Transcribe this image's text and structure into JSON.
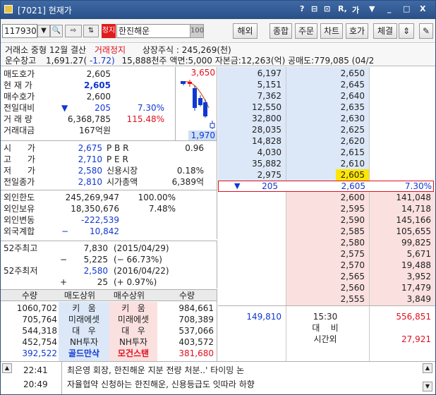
{
  "window": {
    "title": "[7021] 현재가",
    "buttons": [
      "?",
      "⊟",
      "⊡",
      "R,",
      "가",
      "▼",
      "_",
      "□",
      "X"
    ]
  },
  "toolbar": {
    "code": "117930",
    "short_tag": "정지",
    "name": "한진해운",
    "suffix": "100",
    "buttons": [
      "해외",
      "종합",
      "주문",
      "차트",
      "호가",
      "체결"
    ]
  },
  "info": {
    "line1_a": "거래소 중형 12월 결산",
    "line1_b": "거래정지",
    "line1_c": "상장주식 : 245,269(천)",
    "line2_a": "운수창고",
    "line2_b": "1,691.27(",
    "line2_c": "-1.72)",
    "line2_d": "15,888천주 액면:5,000 자본금:12,263(억) 공매도:779,085 (04/2"
  },
  "quote": {
    "rows": [
      {
        "label": "매도호가",
        "value": "2,605",
        "cls": "bk"
      },
      {
        "label": "현 재 가",
        "value": "2,605",
        "cls": "b"
      },
      {
        "label": "매수호가",
        "value": "2,600",
        "cls": "bk"
      },
      {
        "label": "전일대비",
        "arrow": "▼",
        "value": "205",
        "pct": "7.30%",
        "cls": "b"
      },
      {
        "label": "거 래 량",
        "value": "6,368,785",
        "pct": "115.48%",
        "cls": "bk"
      },
      {
        "label": "거래대금",
        "value": "167억원",
        "cls": "bk"
      }
    ],
    "chart_high": "3,650",
    "chart_low": "1,970"
  },
  "prices": [
    {
      "l": "시      가",
      "v": "2,675",
      "k": "P B R",
      "kv": "0.96"
    },
    {
      "l": "고      가",
      "v": "2,710",
      "k": "P E R",
      "kv": ""
    },
    {
      "l": "저      가",
      "v": "2,580",
      "k": "신용시장",
      "kv": "0.18%"
    },
    {
      "l": "전일종가",
      "v": "2,810",
      "k": "시가총액",
      "kv": "6,389억"
    }
  ],
  "foreign": [
    {
      "l": "외인한도",
      "v": "245,269,947",
      "p": "100.00%",
      "cls": "bk"
    },
    {
      "l": "외인보유",
      "v": "18,350,676",
      "p": "7.48%",
      "cls": "bk"
    },
    {
      "l": "외인변동",
      "v": "-222,539",
      "p": "",
      "cls": "b"
    },
    {
      "l": "외국계합",
      "pre": "−",
      "v": "10,842",
      "p": "",
      "cls": "b"
    }
  ],
  "week52": {
    "high_label": "52주최고",
    "high": "7,830",
    "high_date": "(2015/04/29)",
    "hd_sign": "−",
    "hd": "5,225",
    "hd_pct": "(−   66.73%)",
    "low_label": "52주최저",
    "low": "2,580",
    "low_date": "(2016/04/22)",
    "ld_sign": "+",
    "ld": "25",
    "ld_pct": "(+    0.97%)"
  },
  "brokers": {
    "headers": [
      "수량",
      "매도상위",
      "매수상위",
      "수량"
    ],
    "rows": [
      {
        "sq": "1060,702",
        "sn": "키   움",
        "bn": "키   움",
        "bq": "984,661"
      },
      {
        "sq": "705,764",
        "sn": "미래에셋",
        "bn": "미래에셋",
        "bq": "708,389"
      },
      {
        "sq": "544,318",
        "sn": "대   우",
        "bn": "대   우",
        "bq": "537,066"
      },
      {
        "sq": "452,754",
        "sn": "NH투자",
        "bn": "NH투자",
        "bq": "403,572"
      },
      {
        "sq": "392,522",
        "sn": "골드만삭",
        "bn": "모건스탠",
        "bq": "381,680"
      }
    ]
  },
  "orderbook": {
    "asks": [
      {
        "q": "6,197",
        "p": "2,650"
      },
      {
        "q": "5,151",
        "p": "2,645"
      },
      {
        "q": "7,362",
        "p": "2,640"
      },
      {
        "q": "12,550",
        "p": "2,635"
      },
      {
        "q": "32,800",
        "p": "2,630"
      },
      {
        "q": "28,035",
        "p": "2,625"
      },
      {
        "q": "14,828",
        "p": "2,620"
      },
      {
        "q": "4,030",
        "p": "2,615"
      },
      {
        "q": "35,882",
        "p": "2,610"
      },
      {
        "q": "2,975",
        "p": "2,605"
      }
    ],
    "current": {
      "arrow": "▼",
      "change": "205",
      "price": "2,605",
      "pct": "7.30%"
    },
    "bids": [
      {
        "p": "2,600",
        "q": "141,048"
      },
      {
        "p": "2,595",
        "q": "14,718"
      },
      {
        "p": "2,590",
        "q": "145,166"
      },
      {
        "p": "2,585",
        "q": "105,655"
      },
      {
        "p": "2,580",
        "q": "99,825"
      },
      {
        "p": "2,575",
        "q": "5,671"
      },
      {
        "p": "2,570",
        "q": "19,488"
      },
      {
        "p": "2,565",
        "q": "3,952"
      },
      {
        "p": "2,560",
        "q": "17,479"
      },
      {
        "p": "2,555",
        "q": "3,849"
      }
    ],
    "total_ask": "149,810",
    "time": "15:30",
    "total_bid": "556,851",
    "daebi": "대    비",
    "after_label": "시간외",
    "after_val": "27,921"
  },
  "news": [
    {
      "time": "22:41",
      "text": "최은영 회장, 한진해운 지분 전량 처분..' 타이밍 논"
    },
    {
      "time": "20:49",
      "text": "자율협약 신청하는 한진해운, 신용등급도 잇따라 하향"
    }
  ]
}
